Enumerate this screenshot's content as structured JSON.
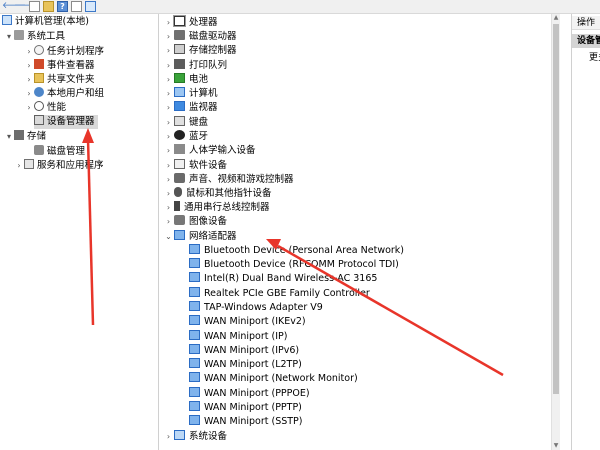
{
  "toolbar": {
    "icons": [
      "back-arrow-icon",
      "forward-arrow-icon",
      "console-tree-icon",
      "properties-folder-icon",
      "help-icon",
      "window-icon",
      "monitor-icon"
    ],
    "back": "🡐",
    "forward": "🡒",
    "help": "?"
  },
  "left_tree": {
    "root": "计算机管理(本地)",
    "system_tools": "系统工具",
    "task_scheduler": "任务计划程序",
    "event_viewer": "事件查看器",
    "shared_folders": "共享文件夹",
    "local_users": "本地用户和组",
    "performance": "性能",
    "device_manager": "设备管理器",
    "storage": "存储",
    "disk_mgmt": "磁盘管理",
    "services_apps": "服务和应用程序"
  },
  "device_tree": {
    "categories_top": [
      "处理器",
      "磁盘驱动器",
      "存储控制器",
      "打印队列",
      "电池",
      "计算机",
      "监视器",
      "键盘",
      "蓝牙",
      "人体学输入设备",
      "软件设备",
      "声音、视频和游戏控制器",
      "鼠标和其他指针设备",
      "通用串行总线控制器",
      "图像设备"
    ],
    "network_adapters": "网络适配器",
    "adapters": [
      "Bluetooth Device (Personal Area Network)",
      "Bluetooth Device (RFCOMM Protocol TDI)",
      "Intel(R) Dual Band Wireless-AC 3165",
      "Realtek PCIe GBE Family Controller",
      "TAP-Windows Adapter V9",
      "WAN Miniport (IKEv2)",
      "WAN Miniport (IP)",
      "WAN Miniport (IPv6)",
      "WAN Miniport (L2TP)",
      "WAN Miniport (Network Monitor)",
      "WAN Miniport (PPPOE)",
      "WAN Miniport (PPTP)",
      "WAN Miniport (SSTP)"
    ],
    "system_devices": "系统设备"
  },
  "actions": {
    "header": "操作",
    "item": "设备管理器",
    "sub": "更多操作"
  },
  "colors": {
    "annotation_arrow": "#e8352a",
    "selection": "#d9d9d9"
  }
}
